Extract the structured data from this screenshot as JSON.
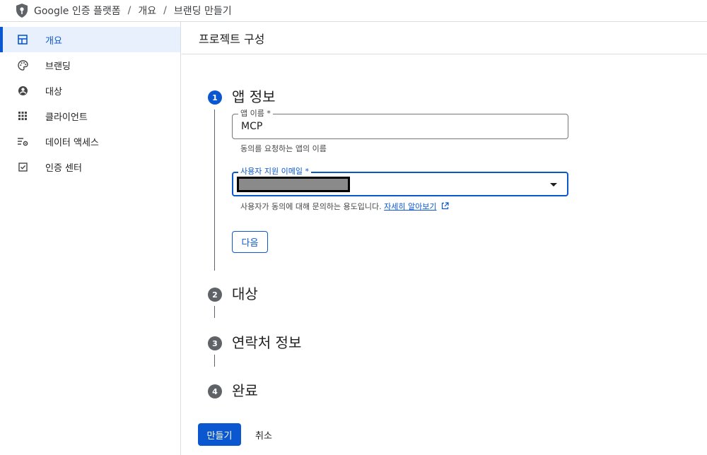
{
  "breadcrumb": {
    "items": [
      "Google 인증 플랫폼",
      "개요",
      "브랜딩 만들기"
    ],
    "separator": "/"
  },
  "sidebar": {
    "items": [
      {
        "label": "개요",
        "icon": "dashboard-icon",
        "active": true
      },
      {
        "label": "브랜딩",
        "icon": "palette-icon",
        "active": false
      },
      {
        "label": "대상",
        "icon": "account-circle-icon",
        "active": false
      },
      {
        "label": "클라이언트",
        "icon": "grid-apps-icon",
        "active": false
      },
      {
        "label": "데이터 액세스",
        "icon": "list-settings-icon",
        "active": false
      },
      {
        "label": "인증 센터",
        "icon": "checkbox-icon",
        "active": false
      }
    ]
  },
  "main": {
    "title": "프로젝트 구성",
    "steps": [
      {
        "number": "1",
        "title": "앱 정보",
        "active": true
      },
      {
        "number": "2",
        "title": "대상",
        "active": false
      },
      {
        "number": "3",
        "title": "연락처 정보",
        "active": false
      },
      {
        "number": "4",
        "title": "완료",
        "active": false
      }
    ],
    "app_name_field": {
      "label": "앱 이름 *",
      "value": "MCP",
      "helper": "동의를 요청하는 앱의 이름"
    },
    "email_field": {
      "label": "사용자 지원 이메일 *",
      "value": "",
      "helper": "사용자가 동의에 대해 문의하는 용도입니다.",
      "learn_more": "자세히 알아보기"
    },
    "next_button": "다음",
    "create_button": "만들기",
    "cancel_button": "취소"
  },
  "colors": {
    "accent": "#0b57d0",
    "active_bg": "#e8f0fe",
    "step_inactive": "#5f6368",
    "border": "#dadce0"
  }
}
